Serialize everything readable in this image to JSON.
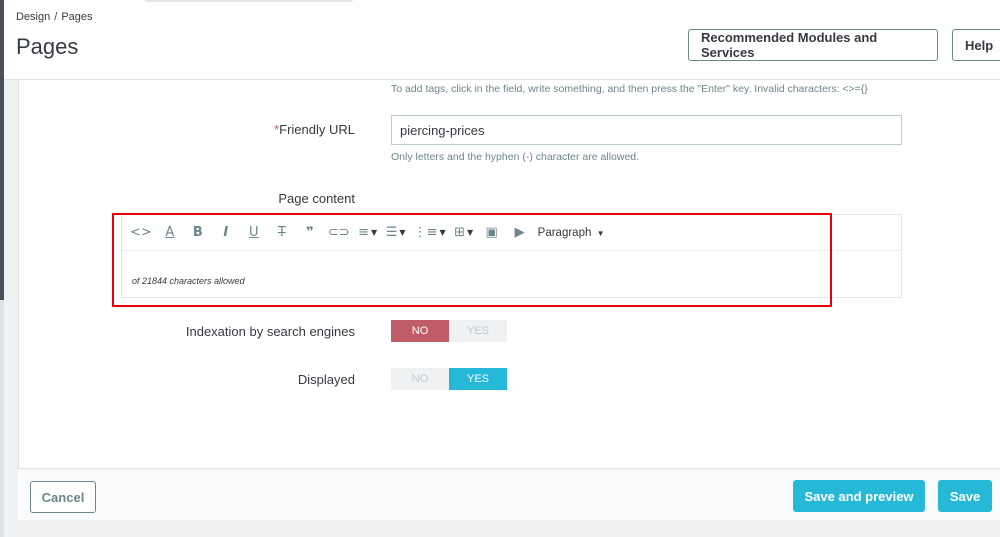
{
  "breadcrumb": {
    "parent": "Design",
    "separator": "/",
    "current": "Pages"
  },
  "header": {
    "title": "Pages",
    "recommended_label": "Recommended Modules and Services",
    "help_label": "Help"
  },
  "form": {
    "tags_help": "To add tags, click in the field, write something, and then press the \"Enter\" key. Invalid characters: <>={}",
    "friendly_url": {
      "required_mark": "*",
      "label": "Friendly URL",
      "value": "piercing-prices",
      "help": "Only letters and the hyphen (-) character are allowed."
    },
    "page_content": {
      "label": "Page content",
      "format_label": "Paragraph",
      "char_count": "of 21844 characters allowed"
    },
    "indexation": {
      "label": "Indexation by search engines",
      "no": "NO",
      "yes": "YES",
      "value": "NO"
    },
    "displayed": {
      "label": "Displayed",
      "no": "NO",
      "yes": "YES",
      "value": "YES"
    }
  },
  "toolbar_icons": [
    "code-icon",
    "font-color-icon",
    "bold-icon",
    "italic-icon",
    "underline-icon",
    "strikethrough-icon",
    "blockquote-icon",
    "link-icon",
    "align-icon",
    "bullet-list-icon",
    "numbered-list-icon",
    "table-icon",
    "image-icon",
    "media-icon"
  ],
  "footer": {
    "cancel_label": "Cancel",
    "save_preview_label": "Save and preview",
    "save_label": "Save"
  },
  "colors": {
    "accent": "#25b9d7",
    "danger": "#c05c67",
    "highlight_box": "#e8000b"
  }
}
